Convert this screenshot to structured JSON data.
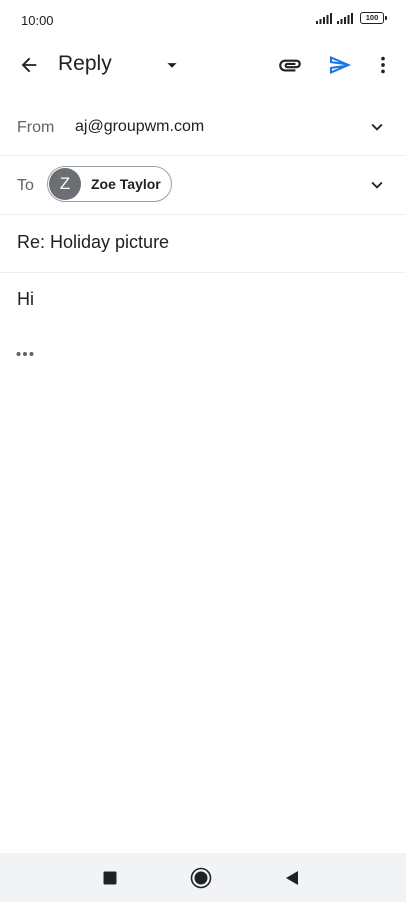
{
  "status_bar": {
    "time": "10:00",
    "battery": "100"
  },
  "app_bar": {
    "title": "Reply",
    "icons": {
      "back": "arrow-left-icon",
      "dropdown": "caret-down-icon",
      "attach": "paperclip-icon",
      "send": "send-icon",
      "more": "more-vert-icon"
    }
  },
  "compose": {
    "from_label": "From",
    "from_value": "aj@groupwm.com",
    "to_label": "To",
    "recipient": {
      "initial": "Z",
      "name": "Zoe Taylor"
    },
    "subject": "Re: Holiday picture",
    "body": "Hi"
  },
  "colors": {
    "send_accent": "#1a73e8",
    "avatar": "#6b6e72",
    "nav_bar": "#f1f3f5"
  }
}
